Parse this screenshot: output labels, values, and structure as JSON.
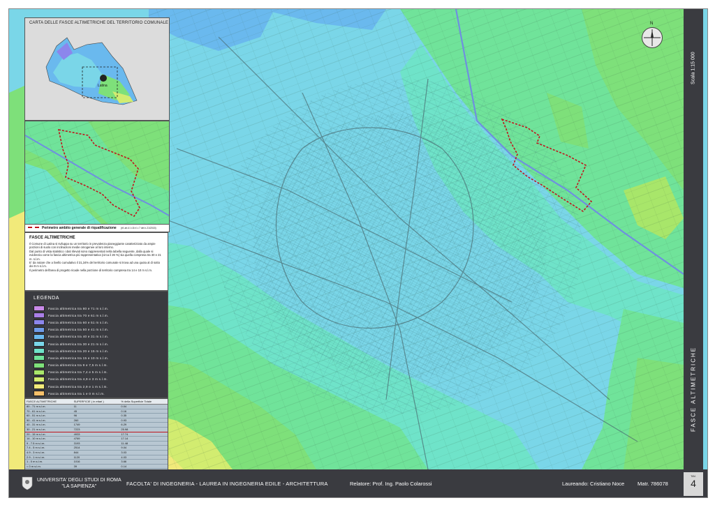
{
  "overview": {
    "title": "CARTA DELLE FASCE ALTIMETRICHE DEL TERRITORIO COMUNALE",
    "town_label": "Latina"
  },
  "perimeter": {
    "label": "Perimetro ambito generale di riqualificazione",
    "note": "(rif. art.4 l.r.8 e l.r.7 del n.21/2015)"
  },
  "description": {
    "heading": "FASCE ALTIMETRICHE",
    "paragraphs": [
      "Il Comune di Latina si sviluppa su un territorio in prevalenza pianeggiante caratterizzato da ampie porzioni di suolo con inclinazioni medie omogenee al loro interno.",
      "Dal punto di vista statistico i dati rilevati sono rappresentati nella tabella seguente, dalla quale si evidenzia come la fascia altimetrica più rappresentativa (circa il 26 %) sia quella compresa tra 30 e 21 m. s.l.m.",
      "E' da notare che a livello cumulativo il 31,34% del territorio comunale si trova ad una quota al di sotto dei 9 m s.l.m.",
      "Il perimetro dell'area di progetto ricade nella porzione di territorio compresa tra 14 e 10 m s.l.m."
    ]
  },
  "legend": {
    "title": "LEGENDA",
    "items": [
      {
        "label": "Fascia altimetrica tra 80 e 71 m s.l.m.",
        "color": "#c88ae8"
      },
      {
        "label": "Fascia altimetrica tra 70 e 61 m s.l.m.",
        "color": "#a97fe6"
      },
      {
        "label": "Fascia altimetrica tra 60 e 51 m s.l.m.",
        "color": "#8c86ec"
      },
      {
        "label": "Fascia altimetrica tra 50 e 41 m s.l.m.",
        "color": "#6e9be8"
      },
      {
        "label": "Fascia altimetrica tra 40 e 31 m s.l.m.",
        "color": "#6ab9ee"
      },
      {
        "label": "Fascia altimetrica tra 30 e 21 m s.l.m.",
        "color": "#7ad6e8"
      },
      {
        "label": "Fascia altimetrica tra 20 e 15 m s.l.m.",
        "color": "#6fe3c9"
      },
      {
        "label": "Fascia altimetrica tra 15 e 10 m s.l.m.",
        "color": "#70e39a"
      },
      {
        "label": "Fascia altimetrica tra 9 e 7,5 m s.l.m.",
        "color": "#7ee07a"
      },
      {
        "label": "Fascia altimetrica tra 7,4 e 5 m s.l.m.",
        "color": "#a8e66a"
      },
      {
        "label": "Fascia altimetrica tra 4,9 e 3 m s.l.m.",
        "color": "#d2ec70"
      },
      {
        "label": "Fascia altimetrica tra 2,9 e 1 m s.l.m.",
        "color": "#f1ea7a"
      },
      {
        "label": "Fascia altimetrica tra 1 e 0 m s.l.m.",
        "color": "#f6c06a"
      },
      {
        "label": "Fascia altimetrica < di 0 m s.l.m.",
        "color": "#ee8b5a"
      }
    ]
  },
  "table": {
    "headers": [
      "FASCE ALTIMETRICHE",
      "SUPERFICIE ( in ettari )",
      "% della Superficie Totale"
    ],
    "rows": [
      [
        "80 - 71 m s.l.m.",
        "11",
        "0.04"
      ],
      [
        "70 - 61 m s.l.m.",
        "45",
        "0.16"
      ],
      [
        "60 - 51 m s.l.m.",
        "96",
        "0.35"
      ],
      [
        "50 - 41 m s.l.m.",
        "260",
        "0.93"
      ],
      [
        "40 - 31 m s.l.m.",
        "1749",
        "6.29"
      ],
      [
        "30 - 21 m s.l.m.",
        "7223",
        "25.98"
      ],
      [
        "20 - 15 m s.l.m.",
        "4933",
        "17.74"
      ],
      [
        "14 - 10 m s.l.m.",
        "4769",
        "17.14"
      ],
      [
        "9 - 7.5 m s.l.m.",
        "3193",
        "11.48"
      ],
      [
        "7.4 - 5 m s.l.m.",
        "2514",
        "9.04"
      ],
      [
        "4.9 - 3 m s.l.m.",
        "844",
        "3.03"
      ],
      [
        "2.9 - 1 m s.l.m.",
        "1120",
        "4.03"
      ],
      [
        "1 - 0 m s.l.m.",
        "1016",
        "3.66"
      ],
      [
        "< 0 m s.l.m.",
        "39",
        "0.14"
      ],
      [
        "TOTALI",
        "27799",
        "100.00"
      ]
    ],
    "highlight_row": 5
  },
  "sidebar": {
    "scale": "Scala 1:15 000",
    "title": "FASCE ALTIMETRICHE"
  },
  "compass": {
    "north": "N"
  },
  "footer": {
    "university_line1": "UNIVERSITA' DEGLI STUDI DI ROMA",
    "university_line2": "\"LA SAPIENZA\"",
    "faculty": "FACOLTA' DI INGEGNERIA  -  LAUREA IN INGEGNERIA EDILE - ARCHITETTURA",
    "relatore": "Relatore: Prof. Ing. Paolo Colarossi",
    "laureando": "Laureando: Cristiano Noce",
    "matricola": "Matr. 786078",
    "tav_label": "TAV.",
    "tav_number": "4"
  }
}
